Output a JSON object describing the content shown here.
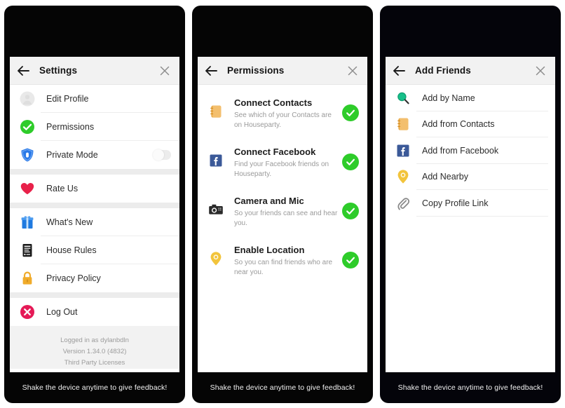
{
  "shake_hint": "Shake the device anytime to give feedback!",
  "icons": {
    "back": "back-arrow-icon",
    "close": "close-x-icon"
  },
  "panels": [
    {
      "id": "settings",
      "title": "Settings",
      "sections": [
        {
          "rows": [
            {
              "label": "Edit Profile",
              "icon": "avatar-placeholder-icon"
            },
            {
              "label": "Permissions",
              "icon": "green-check-circle-icon"
            },
            {
              "label": "Private Mode",
              "icon": "blue-shield-icon",
              "toggle": "off"
            }
          ]
        },
        {
          "rows": [
            {
              "label": "Rate Us",
              "icon": "red-heart-icon"
            }
          ]
        },
        {
          "rows": [
            {
              "label": "What's New",
              "icon": "blue-gift-icon"
            },
            {
              "label": "House Rules",
              "icon": "document-rules-icon"
            },
            {
              "label": "Privacy Policy",
              "icon": "yellow-padlock-icon"
            }
          ]
        },
        {
          "rows": [
            {
              "label": "Log Out",
              "icon": "red-x-circle-icon"
            }
          ]
        }
      ],
      "footer_lines": [
        "Logged in as dylanbdln",
        "Version 1.34.0 (4832)",
        "Third Party Licenses"
      ]
    },
    {
      "id": "permissions",
      "title": "Permissions",
      "items": [
        {
          "title": "Connect Contacts",
          "subtitle": "See which of your Contacts are on Houseparty.",
          "icon": "orange-contacts-book-icon",
          "status": "enabled"
        },
        {
          "title": "Connect Facebook",
          "subtitle": "Find your Facebook friends on Houseparty.",
          "icon": "facebook-icon",
          "status": "enabled"
        },
        {
          "title": "Camera and Mic",
          "subtitle": "So your friends can see and hear you.",
          "icon": "camera-icon",
          "status": "enabled"
        },
        {
          "title": "Enable Location",
          "subtitle": "So you can find friends who are near you.",
          "icon": "yellow-location-pin-icon",
          "status": "enabled"
        }
      ]
    },
    {
      "id": "add-friends",
      "title": "Add Friends",
      "items": [
        {
          "label": "Add by Name",
          "icon": "green-magnifier-icon"
        },
        {
          "label": "Add from Contacts",
          "icon": "orange-contacts-book-icon"
        },
        {
          "label": "Add from Facebook",
          "icon": "facebook-icon"
        },
        {
          "label": "Add Nearby",
          "icon": "yellow-location-pin-icon"
        },
        {
          "label": "Copy Profile Link",
          "icon": "paperclip-icon"
        }
      ]
    }
  ],
  "colors": {
    "green": "#2ecc2a",
    "facebook_blue": "#3b5998",
    "shield_blue": "#2979e8",
    "heart_red": "#e8214a",
    "logout_pink": "#e51a57",
    "lock_yellow": "#f0ab2a",
    "pin_yellow": "#f2c43c",
    "contacts_orange": "#e8a845",
    "gift_blue": "#1f7ae0",
    "header_bg": "#f2f2f2",
    "bezel": "#050505"
  }
}
